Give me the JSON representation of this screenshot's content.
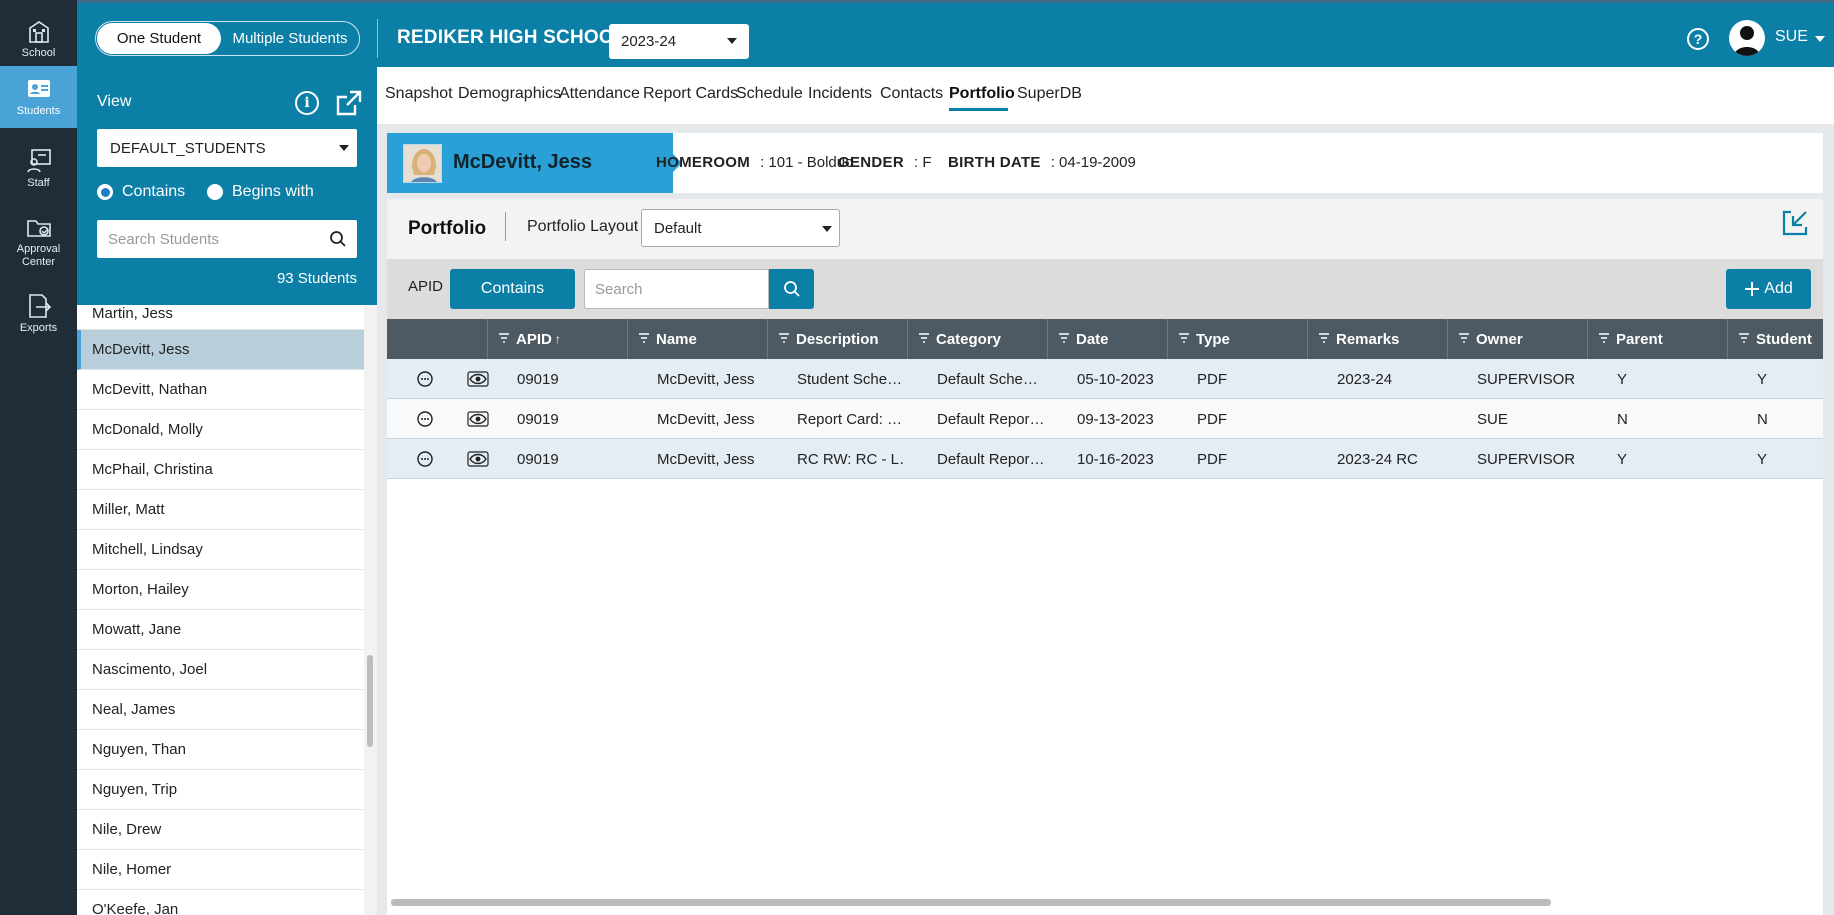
{
  "rail": [
    {
      "label": "School",
      "icon": "school-icon"
    },
    {
      "label": "Students",
      "icon": "students-icon",
      "active": true
    },
    {
      "label": "Staff",
      "icon": "staff-icon"
    },
    {
      "label": "Approval Center",
      "icon": "approval-icon"
    },
    {
      "label": "Exports",
      "icon": "exports-icon"
    }
  ],
  "header": {
    "toggle_one": "One Student",
    "toggle_multi": "Multiple Students",
    "school_name": "REDIKER HIGH SCHOOL",
    "year": "2023-24",
    "user": "SUE"
  },
  "sidebar": {
    "view_label": "View",
    "view_value": "DEFAULT_STUDENTS",
    "radio_contains": "Contains",
    "radio_begins": "Begins with",
    "search_placeholder": "Search Students",
    "count": "93 Students",
    "students": [
      "Martin, Jess",
      "McDevitt, Jess",
      "McDevitt, Nathan",
      "McDonald, Molly",
      "McPhail, Christina",
      "Miller, Matt",
      "Mitchell, Lindsay",
      "Morton, Hailey",
      "Mowatt, Jane",
      "Nascimento, Joel",
      "Neal, James",
      "Nguyen, Than",
      "Nguyen, Trip",
      "Nile, Drew",
      "Nile, Homer",
      "O'Keefe, Jan"
    ],
    "selected_index": 1
  },
  "tabs": [
    "Snapshot",
    "Demographics",
    "Attendance",
    "Report Cards",
    "Schedule",
    "Incidents",
    "Contacts",
    "Portfolio",
    "SuperDB"
  ],
  "active_tab": "Portfolio",
  "student": {
    "name": "McDevitt, Jess",
    "homeroom_label": "HOMEROOM",
    "homeroom": ": 101 - Bolduc",
    "gender_label": "GENDER",
    "gender": ": F",
    "birth_label": "BIRTH DATE",
    "birth": ": 04-19-2009"
  },
  "portfolio": {
    "title": "Portfolio",
    "layout_label": "Portfolio Layout",
    "layout_value": "Default",
    "filter_field": "APID",
    "filter_mode": "Contains",
    "search_placeholder": "Search",
    "add_label": "Add",
    "columns": [
      "APID",
      "Name",
      "Description",
      "Category",
      "Date",
      "Type",
      "Remarks",
      "Owner",
      "Parent",
      "Student"
    ],
    "sort_indicator": "↑",
    "rows": [
      [
        "09019",
        "McDevitt, Jess",
        "Student Sche…",
        "Default Sche…",
        "05-10-2023",
        "PDF",
        "2023-24",
        "SUPERVISOR",
        "Y",
        "Y"
      ],
      [
        "09019",
        "McDevitt, Jess",
        "Report Card: …",
        "Default Repor…",
        "09-13-2023",
        "PDF",
        "",
        "SUE",
        "N",
        "N"
      ],
      [
        "09019",
        "McDevitt, Jess",
        "RC RW: RC - L…",
        "Default Repor…",
        "10-16-2023",
        "PDF",
        "2023-24 RC",
        "SUPERVISOR",
        "Y",
        "Y"
      ]
    ]
  },
  "colors": {
    "brand": "#0b7fa6",
    "rail": "#1f2d38",
    "rail_active": "#4aa3d6",
    "card_accent": "#29a1d6",
    "table_header": "#4d5a63"
  }
}
